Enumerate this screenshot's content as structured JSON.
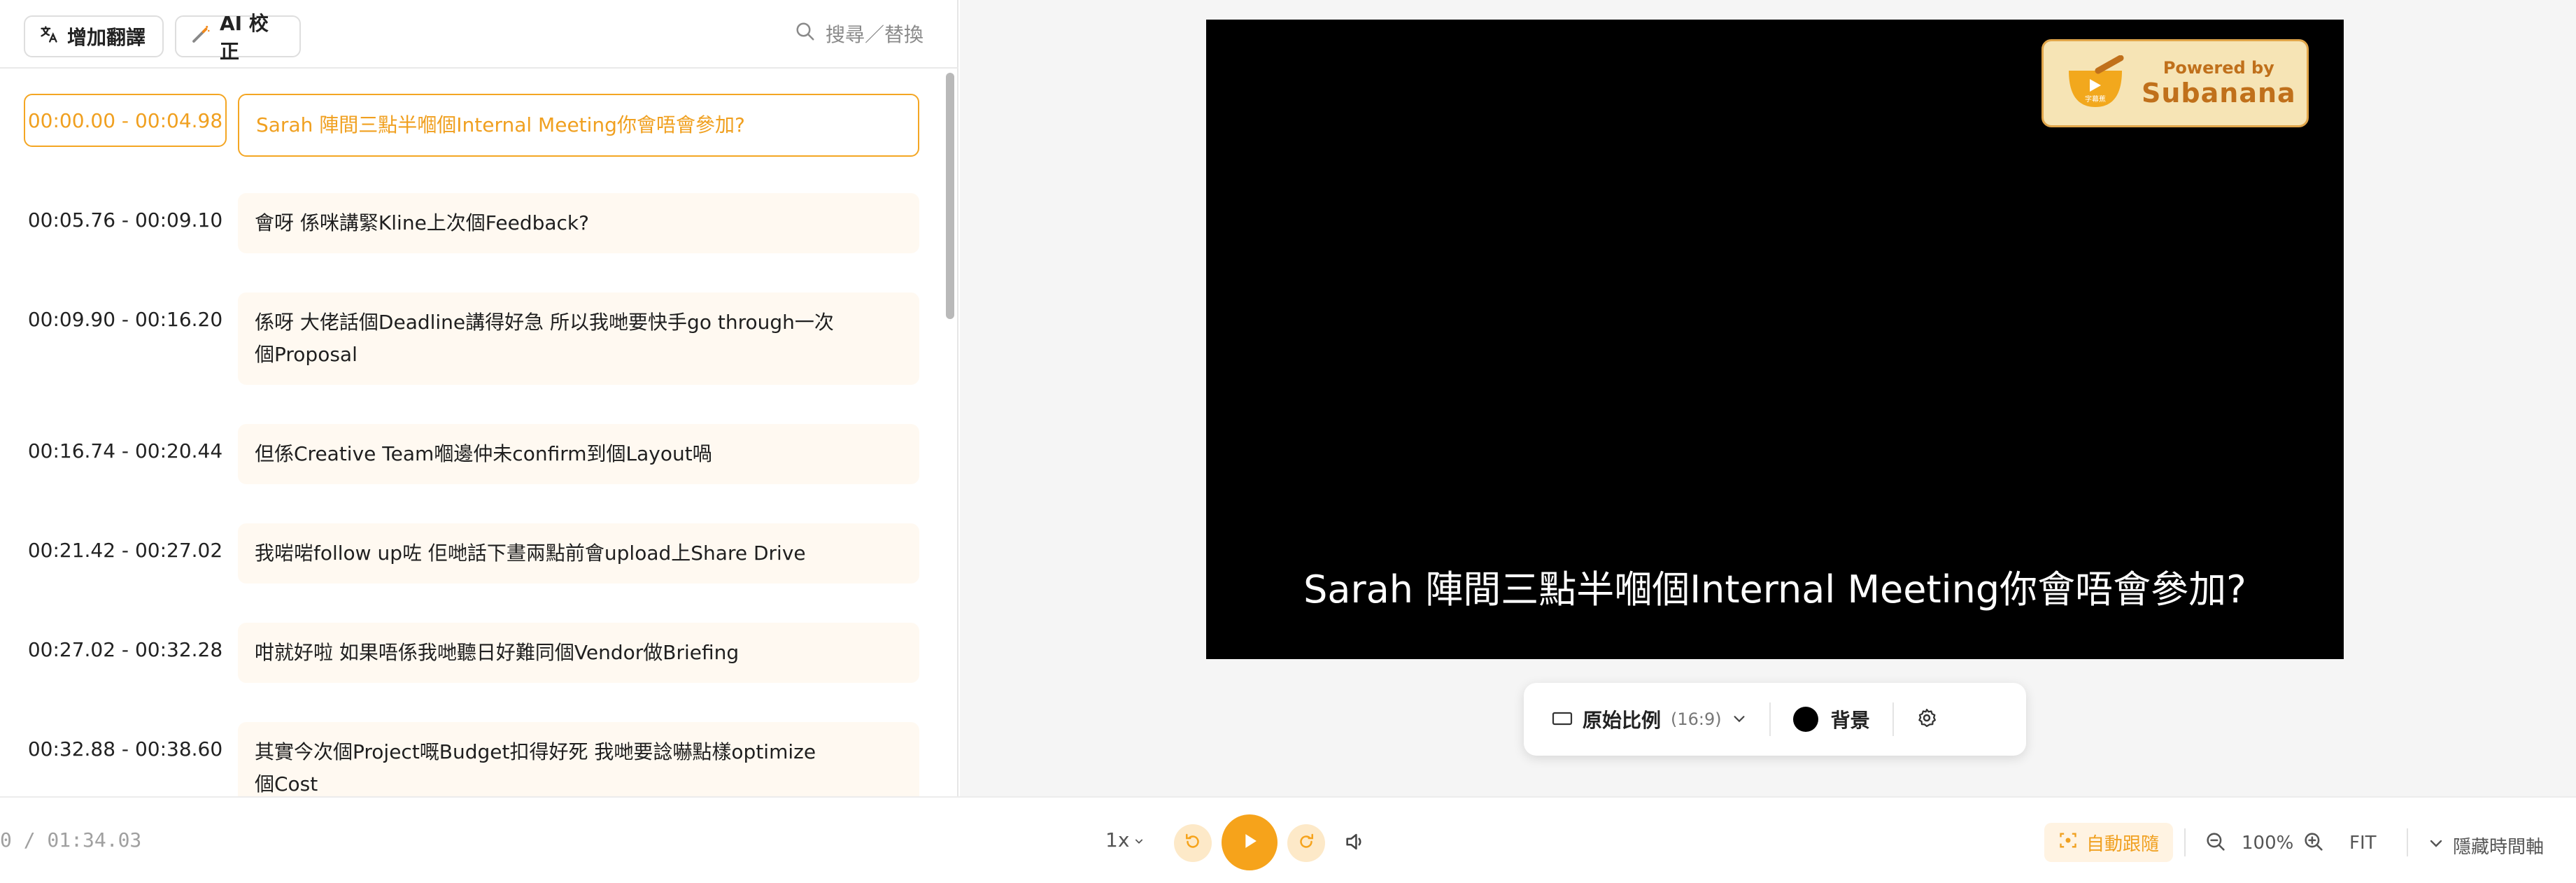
{
  "toolbar": {
    "translate_label": "增加翻譯",
    "ai_label": "AI 校正",
    "search_placeholder": "搜尋／替換"
  },
  "subtitles": [
    {
      "time": "00:00.00 - 00:04.98",
      "text": "Sarah 陣間三點半嗰個Internal Meeting你會唔會參加?",
      "active": true
    },
    {
      "time": "00:05.76 - 00:09.10",
      "text": "會呀 係咪講緊Kline上次個Feedback?"
    },
    {
      "time": "00:09.90 - 00:16.20",
      "text": "係呀 大佬話個Deadline講得好急 所以我哋要快手go through一次個Proposal"
    },
    {
      "time": "00:16.74 - 00:20.44",
      "text": "但係Creative Team嗰邊仲未confirm到個Layout喎"
    },
    {
      "time": "00:21.42 - 00:27.02",
      "text": "我啱啱follow up咗 佢哋話下晝兩點前會upload上Share Drive"
    },
    {
      "time": "00:27.02 - 00:32.28",
      "text": "咁就好啦 如果唔係我哋聽日好難同個Vendor做Briefing"
    },
    {
      "time": "00:32.88 - 00:38.60",
      "text": "其實今次個Project嘅Budget扣得好死 我哋要諗嚇點樣optimize個Cost"
    }
  ],
  "video": {
    "subtitle": "Sarah 陣間三點半嗰個Internal Meeting你會唔會參加?",
    "watermark_powered": "Powered by",
    "watermark_brand": "Subanana",
    "watermark_logo_caption": "字幕蕉"
  },
  "controls": {
    "ratio_label": "原始比例",
    "ratio_sub": "(16:9)",
    "background_label": "背景"
  },
  "playback": {
    "timecode": "0 / 01:34.03",
    "speed": "1x",
    "autofollow": "自動跟隨",
    "zoom": "100%",
    "fit": "FIT",
    "hide_timeline": "隱藏時間軸"
  },
  "colors": {
    "accent": "#f4a623",
    "video_bg": "#000000"
  }
}
